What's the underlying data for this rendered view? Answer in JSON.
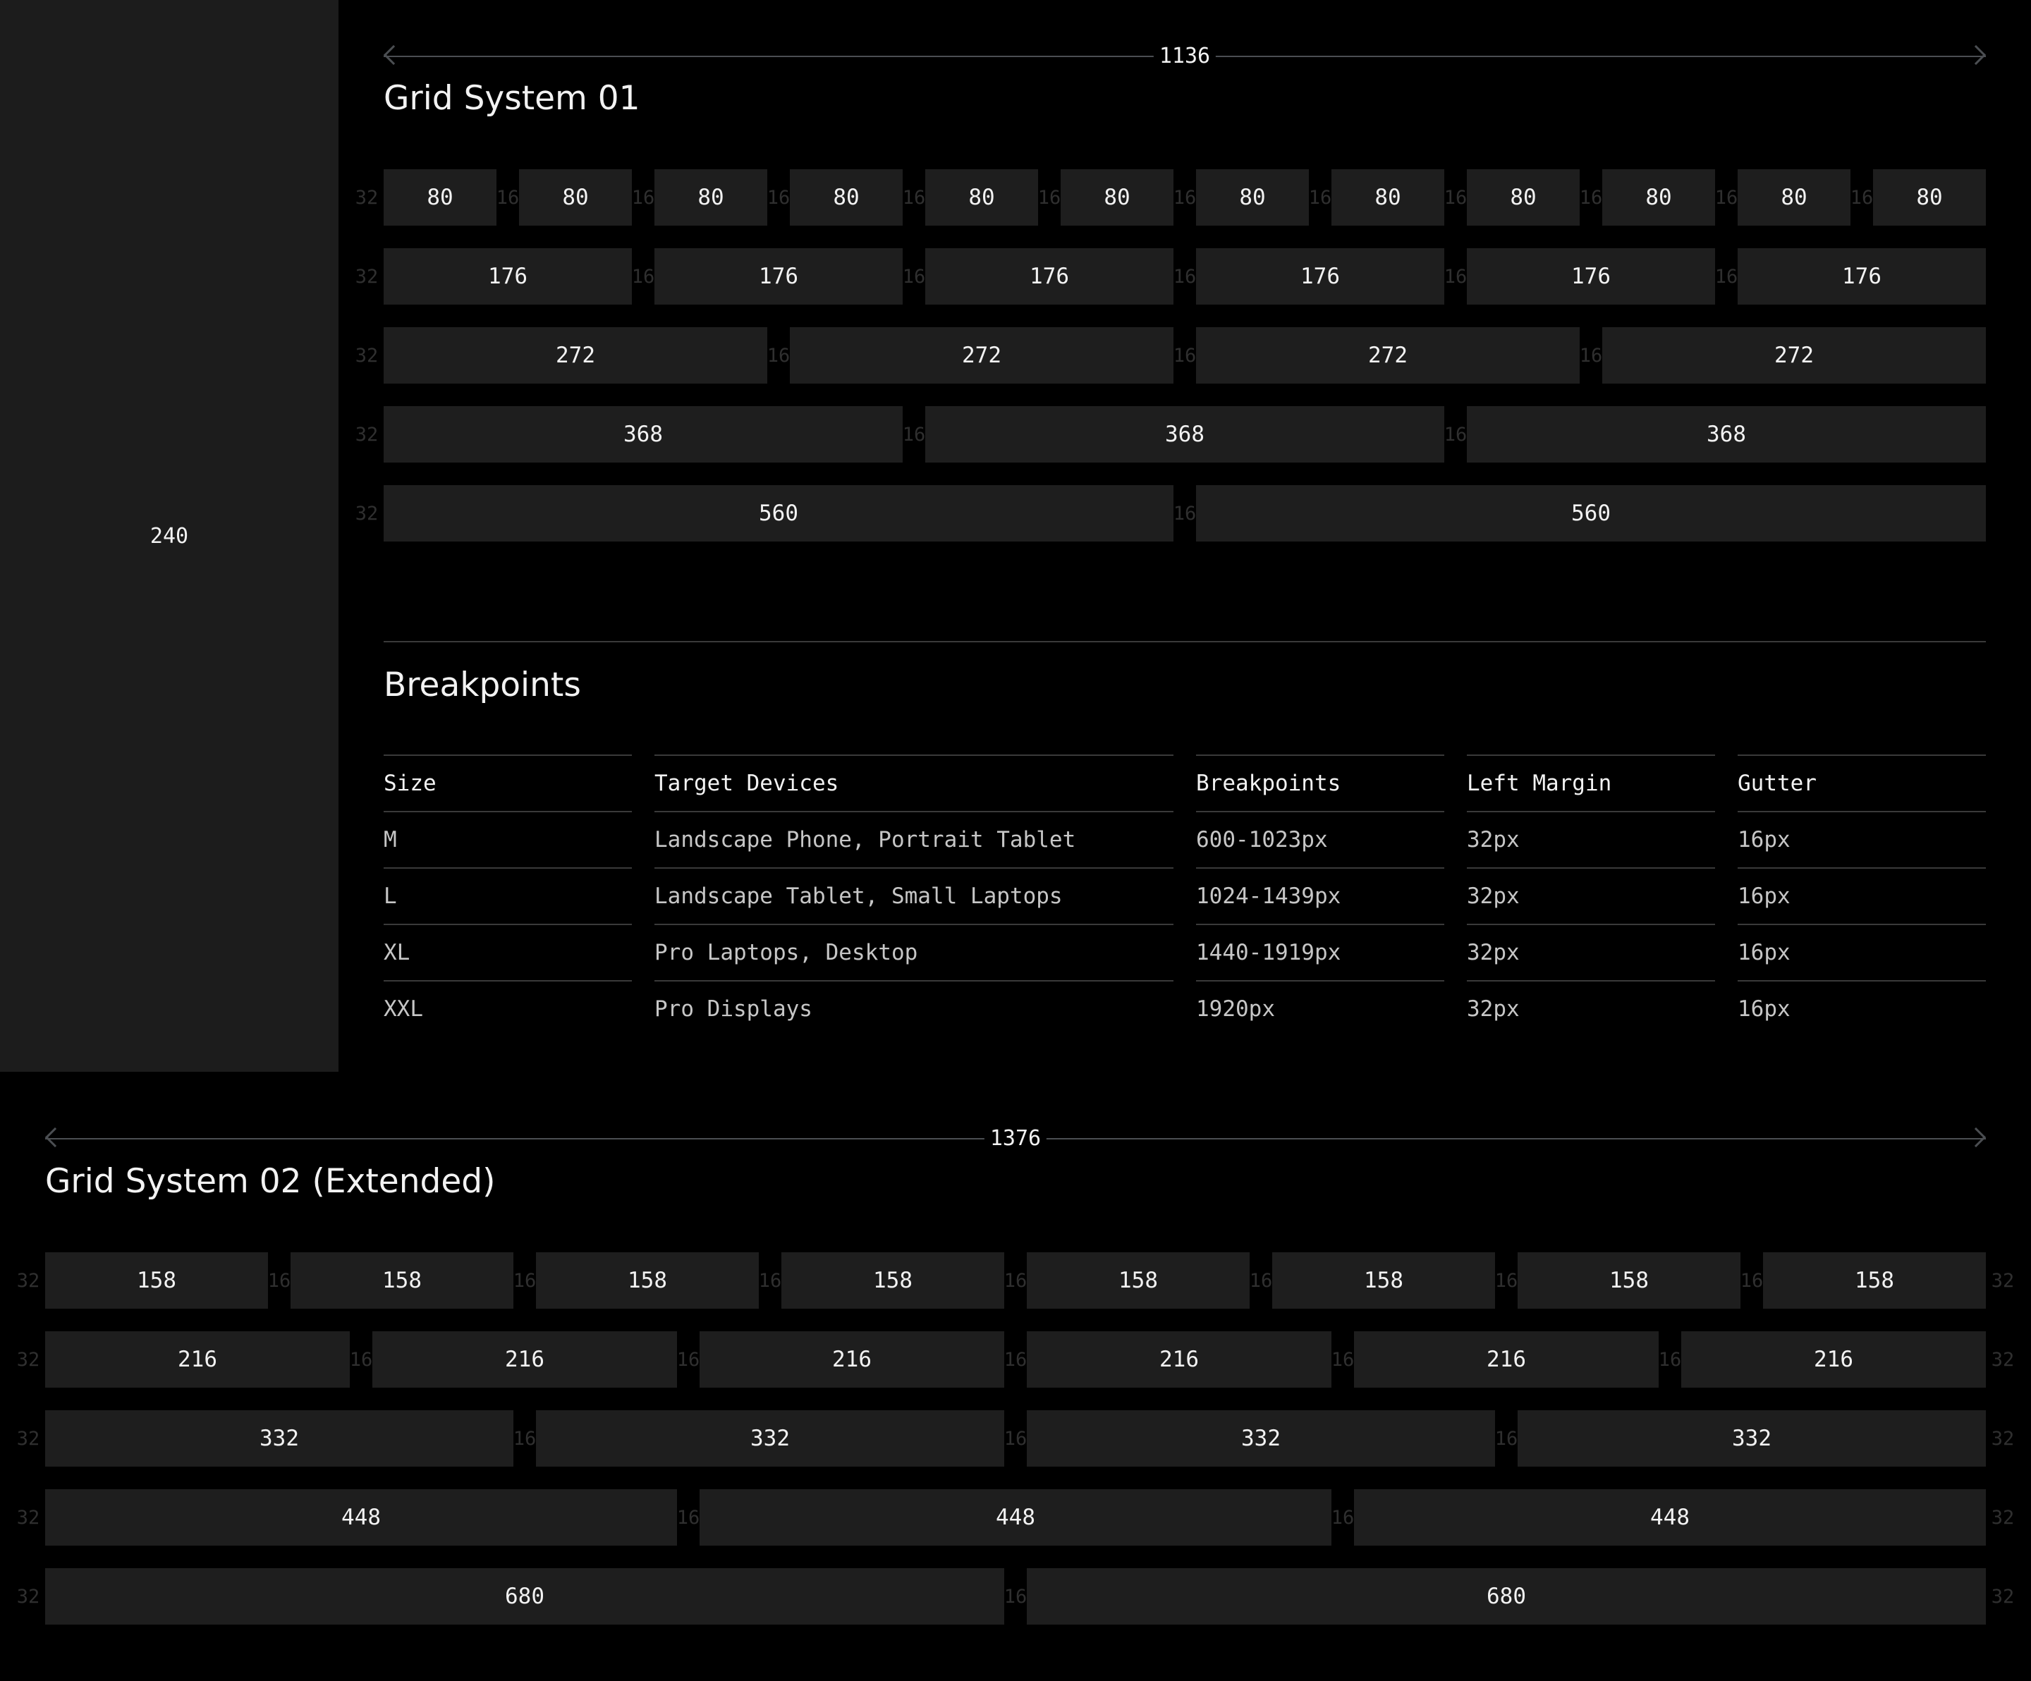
{
  "sidebar": {
    "label": "240"
  },
  "grid01": {
    "width_label": "1136",
    "title": "Grid System 01",
    "margin_label": "32",
    "gutter_label": "16",
    "rows": [
      [
        "80",
        "80",
        "80",
        "80",
        "80",
        "80",
        "80",
        "80",
        "80",
        "80",
        "80",
        "80"
      ],
      [
        "176",
        "176",
        "176",
        "176",
        "176",
        "176"
      ],
      [
        "272",
        "272",
        "272",
        "272"
      ],
      [
        "368",
        "368",
        "368"
      ],
      [
        "560",
        "560"
      ]
    ]
  },
  "breakpoints": {
    "title": "Breakpoints",
    "columns": [
      "Size",
      "Target Devices",
      "Breakpoints",
      "Left Margin",
      "Gutter"
    ],
    "rows": [
      [
        "M",
        "Landscape Phone, Portrait Tablet",
        "600-1023px",
        "32px",
        "16px"
      ],
      [
        "L",
        "Landscape Tablet, Small Laptops",
        "1024-1439px",
        "32px",
        "16px"
      ],
      [
        "XL",
        "Pro Laptops, Desktop",
        "1440-1919px",
        "32px",
        "16px"
      ],
      [
        "XXL",
        "Pro Displays",
        "1920px",
        "32px",
        "16px"
      ]
    ]
  },
  "grid02": {
    "width_label": "1376",
    "title": "Grid System 02 (Extended)",
    "margin_label": "32",
    "gutter_label": "16",
    "rows": [
      [
        "158",
        "158",
        "158",
        "158",
        "158",
        "158",
        "158",
        "158"
      ],
      [
        "216",
        "216",
        "216",
        "216",
        "216",
        "216"
      ],
      [
        "332",
        "332",
        "332",
        "332"
      ],
      [
        "448",
        "448",
        "448"
      ],
      [
        "680",
        "680"
      ]
    ]
  },
  "colors": {
    "background": "#000000",
    "sidebar": "#1c1c1c",
    "cell": "#1e1e1e",
    "text": "#f2f2f2",
    "muted_label": "#2f2f2f",
    "rule": "#3a3a3a"
  }
}
